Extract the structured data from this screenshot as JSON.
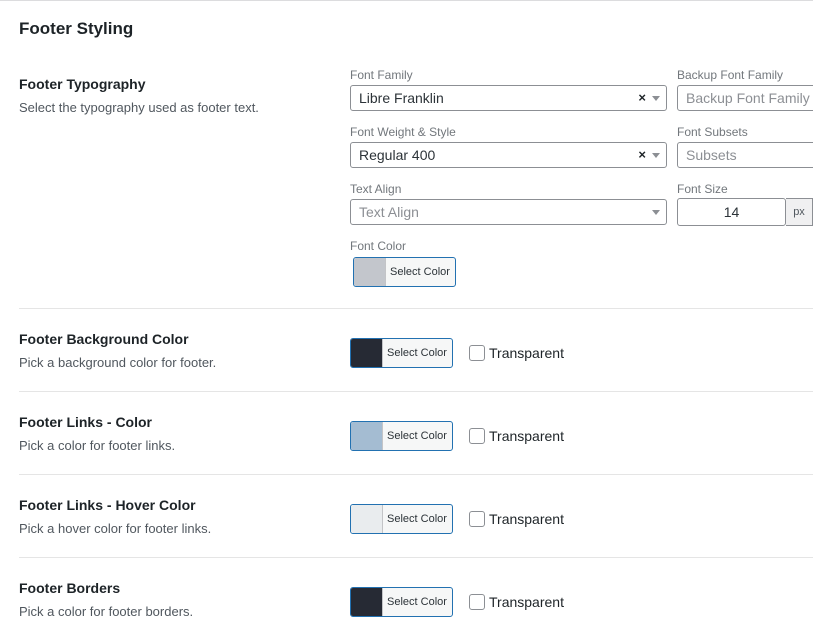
{
  "section": {
    "title": "Footer Styling"
  },
  "typography": {
    "title": "Footer Typography",
    "description": "Select the typography used as footer text.",
    "font_family": {
      "label": "Font Family",
      "value": "Libre Franklin"
    },
    "backup_font_family": {
      "label": "Backup Font Family",
      "placeholder": "Backup Font Family"
    },
    "font_weight": {
      "label": "Font Weight & Style",
      "value": "Regular 400"
    },
    "font_subsets": {
      "label": "Font Subsets",
      "placeholder": "Subsets"
    },
    "text_align": {
      "label": "Text Align",
      "placeholder": "Text Align"
    },
    "font_size": {
      "label": "Font Size",
      "value": "14",
      "unit": "px"
    },
    "font_color": {
      "label": "Font Color",
      "button_label": "Select Color",
      "swatch": "#c3c6cc"
    }
  },
  "clear_symbol": "×",
  "fields": [
    {
      "title": "Footer Background Color",
      "description": "Pick a background color for footer.",
      "button_label": "Select Color",
      "swatch": "#262a34",
      "transparent_label": "Transparent"
    },
    {
      "title": "Footer Links - Color",
      "description": "Pick a color for footer links.",
      "button_label": "Select Color",
      "swatch": "#a4bcd2",
      "transparent_label": "Transparent"
    },
    {
      "title": "Footer Links - Hover Color",
      "description": "Pick a hover color for footer links.",
      "button_label": "Select Color",
      "swatch": "#e9ecee",
      "transparent_label": "Transparent"
    },
    {
      "title": "Footer Borders",
      "description": "Pick a color for footer borders.",
      "button_label": "Select Color",
      "swatch": "#262a34",
      "transparent_label": "Transparent"
    }
  ]
}
